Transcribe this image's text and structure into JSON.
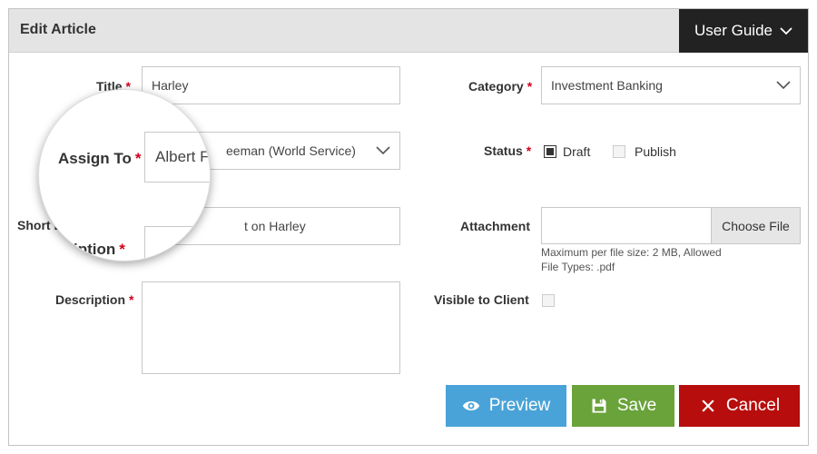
{
  "header": {
    "title": "Edit Article",
    "guide_label": "User Guide"
  },
  "form": {
    "required_marker": "*",
    "title": {
      "label": "Title",
      "value": "Harley"
    },
    "assign_to": {
      "label": "Assign To",
      "value_visible": "eeman (World Service)"
    },
    "short_description": {
      "label_visible": "Short D",
      "value_visible": "t on Harley"
    },
    "description": {
      "label": "Description",
      "value": ""
    },
    "category": {
      "label": "Category",
      "value": "Investment Banking"
    },
    "status": {
      "label": "Status",
      "options": [
        "Draft",
        "Publish"
      ],
      "selected": "Draft"
    },
    "attachment": {
      "label": "Attachment",
      "button_label": "Choose File",
      "hint_line1": "Maximum per file size: 2 MB, Allowed",
      "hint_line2": "File Types: .pdf"
    },
    "visible_to_client": {
      "label": "Visible to Client",
      "checked": false
    }
  },
  "magnifier": {
    "label": "Assign To",
    "value": "Albert F",
    "label2": "iption"
  },
  "actions": {
    "preview": "Preview",
    "save": "Save",
    "cancel": "Cancel"
  },
  "colors": {
    "preview": "#4aa3d8",
    "save": "#6aa33a",
    "cancel": "#b70d0d",
    "required": "#d0021b",
    "header_bg": "#e4e4e4",
    "guide_bg": "#222222"
  },
  "icons": {
    "guide": "chevron-down-icon",
    "preview": "eye-icon",
    "save": "floppy-disk-icon",
    "cancel": "close-icon"
  }
}
